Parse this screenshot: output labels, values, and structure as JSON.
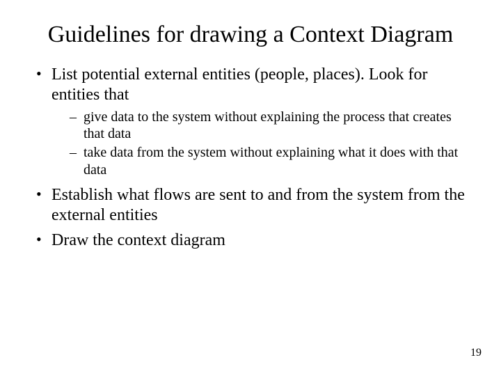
{
  "title": "Guidelines for drawing a Context Diagram",
  "bullets": {
    "b1": "List potential external entities (people, places). Look for entities that",
    "b1_sub1": "give data to the system without explaining the process that creates that data",
    "b1_sub2": "take data from the system without explaining what it does with that data",
    "b2": "Establish what flows are sent to and from  the system from the external entities",
    "b3": "Draw the context diagram"
  },
  "page_number": "19"
}
